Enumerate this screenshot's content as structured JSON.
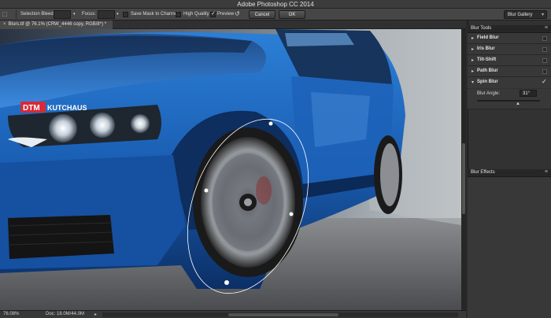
{
  "app": {
    "title": "Adobe Photoshop CC 2014"
  },
  "options_bar": {
    "selection_bleed_label": "Selection Bleed:",
    "focus_label": "Focus:",
    "save_mask_label": "Save Mask to Channels",
    "save_mask_checked": false,
    "high_quality_label": "High Quality",
    "high_quality_checked": false,
    "preview_label": "Preview",
    "preview_checked": true,
    "cancel_label": "Cancel",
    "ok_label": "OK",
    "blur_gallery_label": "Blur Gallery"
  },
  "document": {
    "tab_title": "Blurs.tif @ 76.1% (CRW_4446 copy, RGB/8*) *",
    "close_glyph": "×"
  },
  "image": {
    "brand_red": "DTM",
    "brand_white": "KUTCHAUS"
  },
  "status_bar": {
    "zoom": "76.08%",
    "doc_size": "Doc: 18.0M/44.0M"
  },
  "blur_tools": {
    "header": "Blur Tools",
    "items": [
      {
        "label": "Field Blur",
        "checked": false
      },
      {
        "label": "Iris Blur",
        "checked": false
      },
      {
        "label": "Tilt-Shift",
        "checked": false
      },
      {
        "label": "Path Blur",
        "checked": false
      },
      {
        "label": "Spin Blur",
        "checked": true
      }
    ],
    "blur_angle_label": "Blur Angle:",
    "blur_angle_value": "31°"
  },
  "blur_effects": {
    "header": "Blur Effects"
  },
  "colors": {
    "car_blue": "#1a5fb4",
    "panel_bg": "#323232",
    "brand_red": "#d42b3a"
  }
}
